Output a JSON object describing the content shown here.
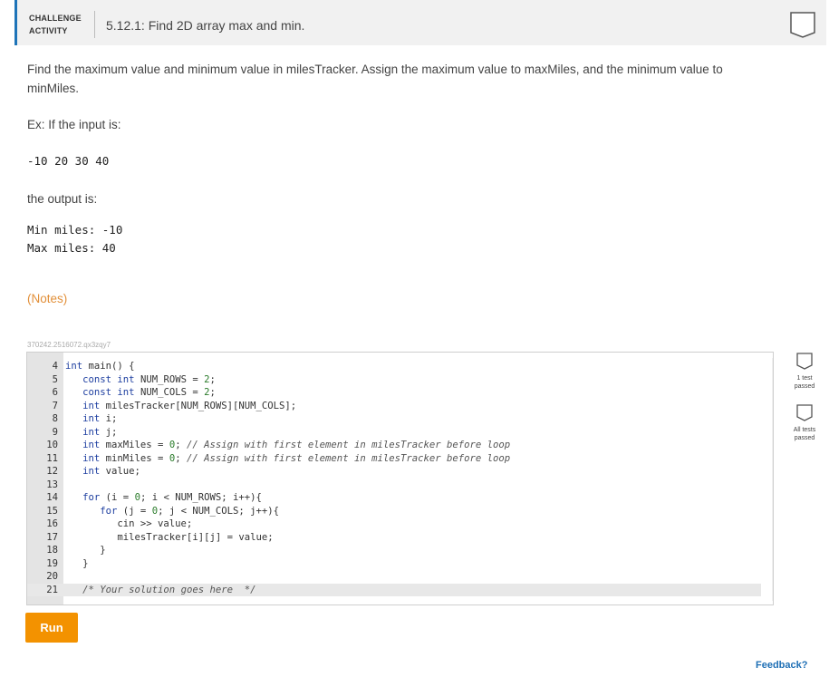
{
  "header": {
    "challenge_line1": "CHALLENGE",
    "challenge_line2": "ACTIVITY",
    "title": "5.12.1: Find 2D array max and min."
  },
  "instructions": {
    "line1": "Find the maximum value and minimum value in milesTracker. Assign the maximum value to maxMiles, and the minimum value to",
    "line2": "minMiles.",
    "example_intro": "Ex: If the input is:",
    "example_input": "-10 20 30 40",
    "output_intro": "the output is:",
    "output_line1": "Min miles: -10",
    "output_line2": "Max miles: 40",
    "notes_link": "(Notes)"
  },
  "code_id": "370242.2516072.qx3zqy7",
  "editor": {
    "lines": [
      {
        "n": "4",
        "t": "int main() {"
      },
      {
        "n": "5",
        "t": "   const int NUM_ROWS = 2;"
      },
      {
        "n": "6",
        "t": "   const int NUM_COLS = 2;"
      },
      {
        "n": "7",
        "t": "   int milesTracker[NUM_ROWS][NUM_COLS];"
      },
      {
        "n": "8",
        "t": "   int i;"
      },
      {
        "n": "9",
        "t": "   int j;"
      },
      {
        "n": "10",
        "t": "   int maxMiles = 0; // Assign with first element in milesTracker before loop"
      },
      {
        "n": "11",
        "t": "   int minMiles = 0; // Assign with first element in milesTracker before loop"
      },
      {
        "n": "12",
        "t": "   int value;"
      },
      {
        "n": "13",
        "t": ""
      },
      {
        "n": "14",
        "t": "   for (i = 0; i < NUM_ROWS; i++){"
      },
      {
        "n": "15",
        "t": "      for (j = 0; j < NUM_COLS; j++){"
      },
      {
        "n": "16",
        "t": "         cin >> value;"
      },
      {
        "n": "17",
        "t": "         milesTracker[i][j] = value;"
      },
      {
        "n": "18",
        "t": "      }"
      },
      {
        "n": "19",
        "t": "   }"
      },
      {
        "n": "20",
        "t": ""
      },
      {
        "n": "21",
        "t": "   /* Your solution goes here  */"
      }
    ]
  },
  "tests": {
    "test1_line1": "1 test",
    "test1_line2": "passed",
    "test2_line1": "All tests",
    "test2_line2": "passed"
  },
  "run_label": "Run",
  "feedback_label": "Feedback?",
  "colors": {
    "accent": "#1e74b8",
    "run": "#f39200",
    "notes": "#e2903a",
    "link": "#1e6fb5"
  }
}
